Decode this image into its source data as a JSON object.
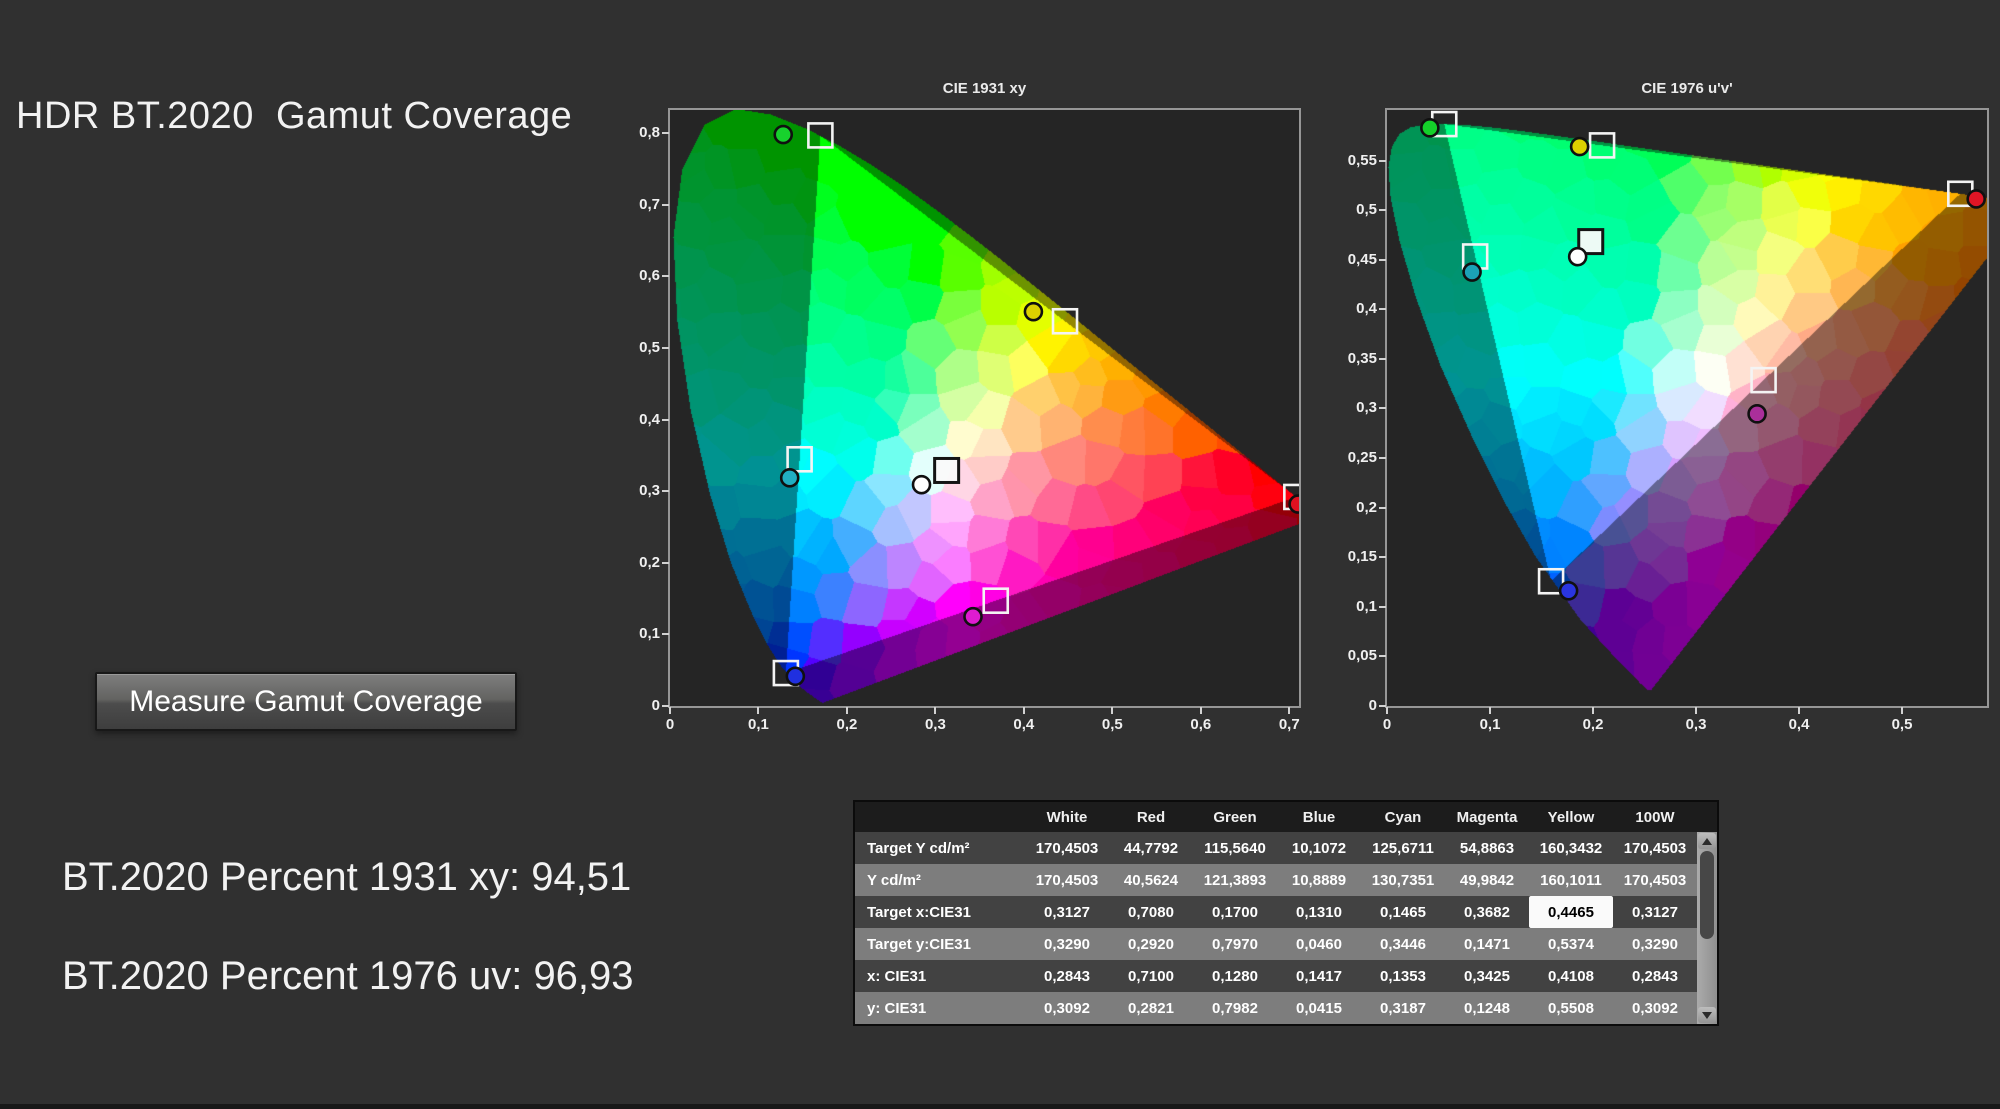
{
  "page": {
    "title": "HDR BT.2020  Gamut Coverage",
    "background": "#303030",
    "plot_background": "#252525"
  },
  "button": {
    "label": "Measure Gamut Coverage"
  },
  "results": [
    {
      "label": "BT.2020 Percent 1931 xy:",
      "value": "94,51"
    },
    {
      "label": "BT.2020 Percent 1976 uv:",
      "value": "96,93"
    }
  ],
  "chart_data": [
    {
      "type": "scatter",
      "title": "CIE 1931 xy",
      "space": "CIE 1931 xy",
      "xlim": [
        0,
        0.711
      ],
      "ylim": [
        0,
        0.8325
      ],
      "grid": false,
      "x_tick_values": [
        0,
        0.1,
        0.2,
        0.3,
        0.4,
        0.5,
        0.6,
        0.7
      ],
      "x_tick_labels": [
        "0",
        "0,1",
        "0,2",
        "0,3",
        "0,4",
        "0,5",
        "0,6",
        "0,7"
      ],
      "y_tick_values": [
        0,
        0.1,
        0.2,
        0.3,
        0.4,
        0.5,
        0.6,
        0.7,
        0.8
      ],
      "y_tick_labels": [
        "0",
        "0,1",
        "0,2",
        "0,3",
        "0,4",
        "0,5",
        "0,6",
        "0,7",
        "0,8"
      ],
      "gamut_triangle": [
        [
          0.708,
          0.292
        ],
        [
          0.17,
          0.797
        ],
        [
          0.131,
          0.046
        ]
      ],
      "series": [
        {
          "name": "target",
          "marker": "square",
          "points": [
            {
              "name": "White",
              "x": 0.3127,
              "y": 0.329,
              "style": "dark"
            },
            {
              "name": "Red",
              "x": 0.708,
              "y": 0.292
            },
            {
              "name": "Green",
              "x": 0.17,
              "y": 0.797
            },
            {
              "name": "Blue",
              "x": 0.131,
              "y": 0.046
            },
            {
              "name": "Cyan",
              "x": 0.1465,
              "y": 0.3446
            },
            {
              "name": "Magenta",
              "x": 0.3682,
              "y": 0.1471
            },
            {
              "name": "Yellow",
              "x": 0.4465,
              "y": 0.5374
            }
          ]
        },
        {
          "name": "measured",
          "marker": "circle",
          "points": [
            {
              "name": "White",
              "x": 0.2843,
              "y": 0.3092,
              "color": "#ffffff"
            },
            {
              "name": "Red",
              "x": 0.71,
              "y": 0.2821,
              "color": "#e01020"
            },
            {
              "name": "Green",
              "x": 0.128,
              "y": 0.7982,
              "color": "#17d22d"
            },
            {
              "name": "Blue",
              "x": 0.1417,
              "y": 0.0415,
              "color": "#2030e0"
            },
            {
              "name": "Cyan",
              "x": 0.1353,
              "y": 0.3187,
              "color": "#21aec2"
            },
            {
              "name": "Magenta",
              "x": 0.3425,
              "y": 0.1248,
              "color": "#df1cd0"
            },
            {
              "name": "Yellow",
              "x": 0.4108,
              "y": 0.5508,
              "color": "#ddd100"
            }
          ]
        }
      ]
    },
    {
      "type": "scatter",
      "title": "CIE 1976 u'v'",
      "space": "CIE 1976 u'v'",
      "xlim": [
        0,
        0.5825
      ],
      "ylim": [
        0,
        0.601
      ],
      "grid": false,
      "x_tick_values": [
        0,
        0.1,
        0.2,
        0.3,
        0.4,
        0.5
      ],
      "x_tick_labels": [
        "0",
        "0,1",
        "0,2",
        "0,3",
        "0,4",
        "0,5"
      ],
      "y_tick_values": [
        0,
        0.05,
        0.1,
        0.15,
        0.2,
        0.25,
        0.3,
        0.35,
        0.4,
        0.45,
        0.5,
        0.55
      ],
      "y_tick_labels": [
        "0",
        "0,05",
        "0,1",
        "0,15",
        "0,2",
        "0,25",
        "0,3",
        "0,35",
        "0,4",
        "0,45",
        "0,5",
        "0,55"
      ],
      "gamut_triangle": [
        [
          0.5566,
          0.5165
        ],
        [
          0.0556,
          0.5868
        ],
        [
          0.1593,
          0.1258
        ]
      ],
      "series": [
        {
          "name": "target",
          "marker": "square",
          "points": [
            {
              "name": "White",
              "x": 0.1978,
              "y": 0.4683,
              "style": "dark"
            },
            {
              "name": "Red",
              "x": 0.5566,
              "y": 0.5165
            },
            {
              "name": "Green",
              "x": 0.0556,
              "y": 0.5868
            },
            {
              "name": "Blue",
              "x": 0.1593,
              "y": 0.1258
            },
            {
              "name": "Cyan",
              "x": 0.0856,
              "y": 0.4533
            },
            {
              "name": "Magenta",
              "x": 0.3656,
              "y": 0.3286
            },
            {
              "name": "Yellow",
              "x": 0.2088,
              "y": 0.5653
            }
          ]
        },
        {
          "name": "measured",
          "marker": "circle",
          "points": [
            {
              "name": "White",
              "x": 0.1851,
              "y": 0.4531,
              "color": "#ffffff"
            },
            {
              "name": "Red",
              "x": 0.572,
              "y": 0.5113,
              "color": "#e01525"
            },
            {
              "name": "Green",
              "x": 0.0416,
              "y": 0.583,
              "color": "#14d02a"
            },
            {
              "name": "Blue",
              "x": 0.1763,
              "y": 0.1162,
              "color": "#2a35e0"
            },
            {
              "name": "Cyan",
              "x": 0.0826,
              "y": 0.4376,
              "color": "#1ba2b6"
            },
            {
              "name": "Magenta",
              "x": 0.3593,
              "y": 0.2946,
              "color": "#aa2f9a"
            },
            {
              "name": "Yellow",
              "x": 0.187,
              "y": 0.5641,
              "color": "#ddd100"
            }
          ]
        }
      ]
    }
  ],
  "table": {
    "columns": [
      "White",
      "Red",
      "Green",
      "Blue",
      "Cyan",
      "Magenta",
      "Yellow",
      "100W"
    ],
    "rows": [
      {
        "label": "Target Y cd/m²",
        "values": [
          "170,4503",
          "44,7792",
          "115,5640",
          "10,1072",
          "125,6711",
          "54,8863",
          "160,3432",
          "170,4503"
        ]
      },
      {
        "label": "Y cd/m²",
        "values": [
          "170,4503",
          "40,5624",
          "121,3893",
          "10,8889",
          "130,7351",
          "49,9842",
          "160,1011",
          "170,4503"
        ]
      },
      {
        "label": "Target x:CIE31",
        "values": [
          "0,3127",
          "0,7080",
          "0,1700",
          "0,1310",
          "0,1465",
          "0,3682",
          "0,4465",
          "0,3127"
        ]
      },
      {
        "label": "Target y:CIE31",
        "values": [
          "0,3290",
          "0,2920",
          "0,7970",
          "0,0460",
          "0,3446",
          "0,1471",
          "0,5374",
          "0,3290"
        ]
      },
      {
        "label": "x: CIE31",
        "values": [
          "0,2843",
          "0,7100",
          "0,1280",
          "0,1417",
          "0,1353",
          "0,3425",
          "0,4108",
          "0,2843"
        ]
      },
      {
        "label": "y: CIE31",
        "values": [
          "0,3092",
          "0,2821",
          "0,7982",
          "0,0415",
          "0,3187",
          "0,1248",
          "0,5508",
          "0,3092"
        ]
      }
    ],
    "highlighted_cell": {
      "row": 2,
      "col": 6,
      "row_label": "Target x:CIE31",
      "column": "Yellow",
      "value": "0,4465"
    }
  }
}
